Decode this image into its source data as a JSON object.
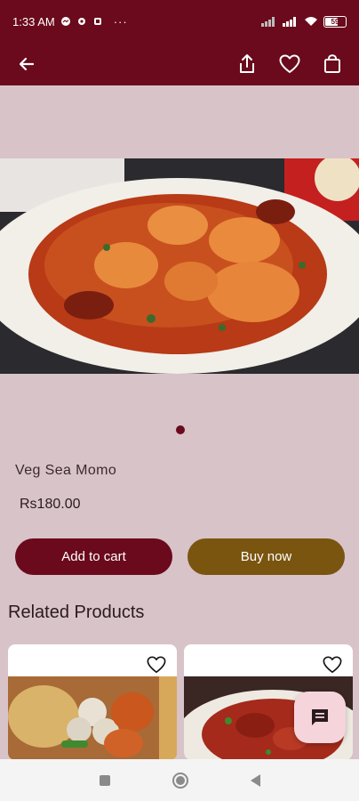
{
  "status_bar": {
    "time": "1:33 AM",
    "more": "···",
    "battery_level": "59"
  },
  "product": {
    "name": "Veg Sea Momo",
    "price": "Rs180.00"
  },
  "actions": {
    "add_to_cart": "Add to cart",
    "buy_now": "Buy now"
  },
  "related": {
    "title": "Related Products"
  },
  "carousel": {
    "active_index": 1,
    "total": 1
  },
  "colors": {
    "primary": "#6a0a1c",
    "secondary": "#7a5510",
    "background": "#d8c3c9"
  },
  "icons": {
    "back": "back-arrow-icon",
    "share": "share-icon",
    "favorite": "heart-icon",
    "cart": "shopping-bag-icon",
    "chat": "chat-icon"
  }
}
